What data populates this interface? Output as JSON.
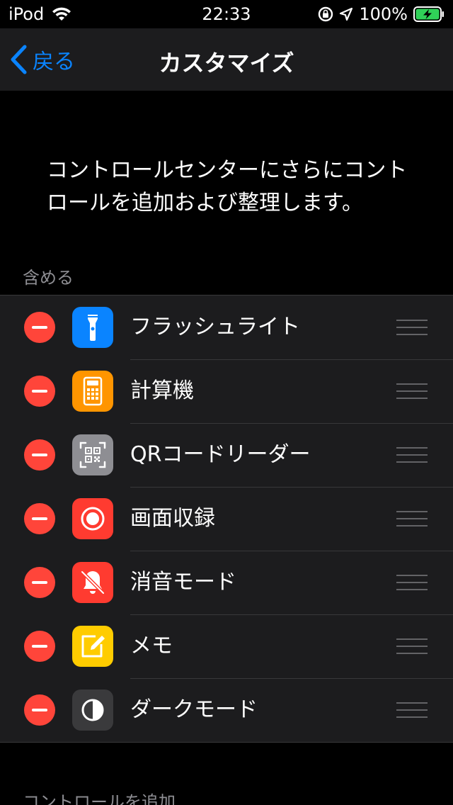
{
  "status_bar": {
    "carrier": "iPod",
    "time": "22:33",
    "battery": "100%",
    "icons": [
      "wifi-icon",
      "orientation-lock-icon",
      "location-icon",
      "battery-charging-icon"
    ]
  },
  "nav": {
    "back_label": "戻る",
    "title": "カスタマイズ"
  },
  "description": "コントロールセンターにさらにコントロールを追加および整理します。",
  "sections": {
    "included_header": "含める",
    "more_header": "コントロールを追加"
  },
  "included_items": [
    {
      "label": "フラッシュライト",
      "icon": "flashlight-icon",
      "color": "#0a84ff"
    },
    {
      "label": "計算機",
      "icon": "calculator-icon",
      "color": "#ff9500"
    },
    {
      "label": "QRコードリーダー",
      "icon": "qr-code-icon",
      "color": "#8e8e93"
    },
    {
      "label": "画面収録",
      "icon": "screen-record-icon",
      "color": "#ff3b30"
    },
    {
      "label": "消音モード",
      "icon": "bell-slash-icon",
      "color": "#ff3b30"
    },
    {
      "label": "メモ",
      "icon": "notes-icon",
      "color": "#ffcc00"
    },
    {
      "label": "ダークモード",
      "icon": "dark-mode-icon",
      "color": "#3a3a3c"
    }
  ],
  "colors": {
    "accent": "#0a84ff",
    "remove": "#ff453a",
    "background": "#000000",
    "cell": "#1c1c1e"
  }
}
